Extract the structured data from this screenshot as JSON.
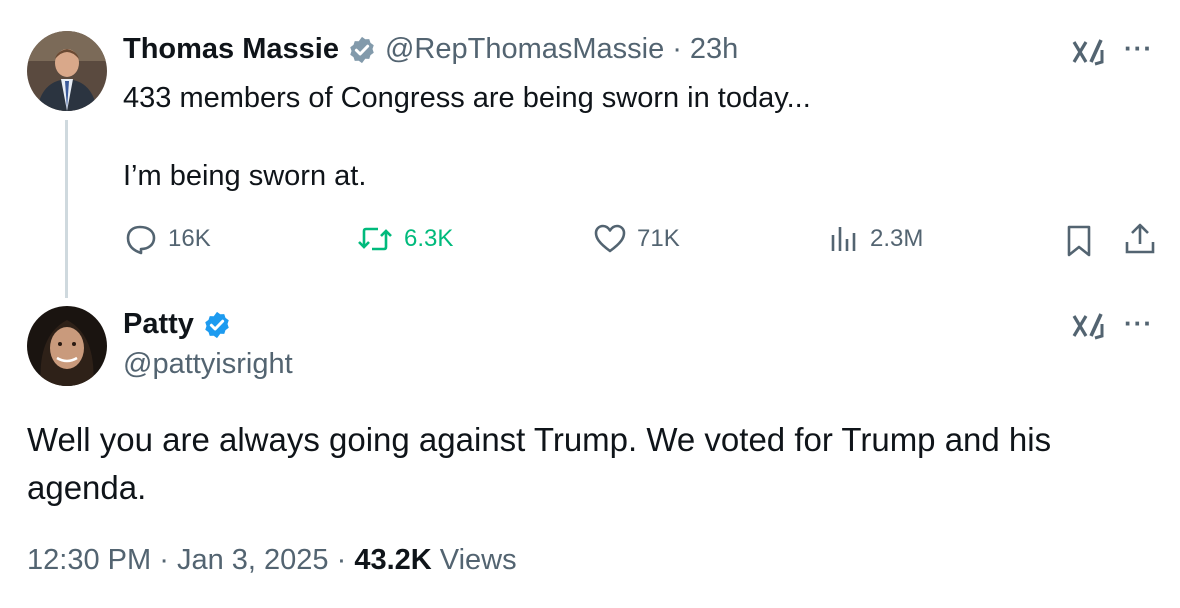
{
  "original": {
    "author_name": "Thomas Massie",
    "handle": "@RepThomasMassie",
    "separator": "·",
    "time": "23h",
    "text_line1": "433 members of Congress are being sworn in today...",
    "text_line2": "I’m being sworn at.",
    "stats": {
      "replies": "16K",
      "reposts": "6.3K",
      "likes": "71K",
      "views": "2.3M"
    },
    "verification": "government-gray",
    "more_label": "···"
  },
  "reply": {
    "author_name": "Patty",
    "handle": "@pattyisright",
    "verification": "blue",
    "text": "Well you are always going against Trump.  We voted for Trump and his agenda.",
    "more_label": "···"
  },
  "meta": {
    "time": "12:30 PM",
    "separator": "·",
    "date": "Jan 3, 2025",
    "views_count": "43.2K",
    "views_label": "Views"
  },
  "colors": {
    "text": "#0f1419",
    "secondary": "#536471",
    "repost": "#00ba7c",
    "verified_blue": "#1d9bf0",
    "verified_gray": "#829aab",
    "thread_line": "#cfd9de"
  }
}
